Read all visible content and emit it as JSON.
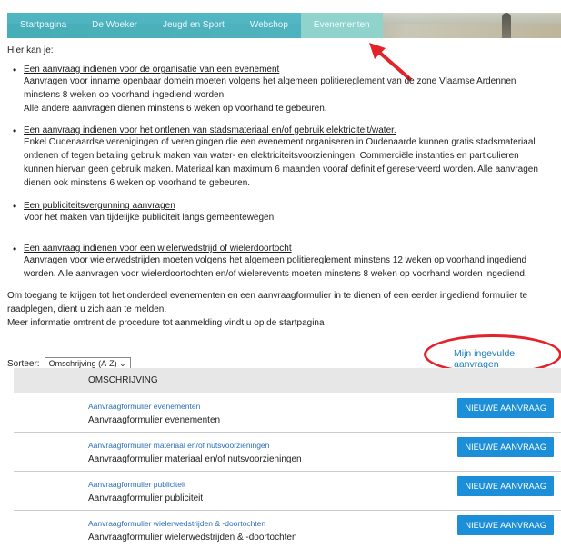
{
  "nav": {
    "items": [
      "Startpagina",
      "De Woeker",
      "Jeugd en Sport",
      "Webshop",
      "Evenementen"
    ],
    "active_index": 4
  },
  "intro": "Hier kan je:",
  "bullets": [
    {
      "title": "Een aanvraag indienen voor de organisatie van een evenement",
      "body": [
        "Aanvragen voor inname openbaar domein moeten volgens het algemeen politiereglement van de zone Vlaamse Ardennen",
        "minstens 8 weken op voorhand ingediend worden.",
        "Alle andere aanvragen dienen minstens 6 weken op voorhand te gebeuren."
      ]
    },
    {
      "title": "Een aanvraag indienen voor het ontlenen van stadsmateriaal en/of gebruik elektriciteit/water.",
      "body": [
        "Enkel Oudenaardse verenigingen of verenigingen die een evenement organiseren in Oudenaarde kunnen gratis stadsmateriaal",
        "ontlenen of tegen betaling gebruik maken van water- en elektriciteitsvoorzieningen. Commerciële instanties en particulieren",
        "kunnen hiervan geen gebruik maken. Materiaal kan maximum 6 maanden vooraf definitief gereserveerd worden. Alle aanvragen",
        "dienen ook minstens 6 weken op voorhand te gebeuren."
      ]
    },
    {
      "title": "Een publiciteitsvergunning aanvragen",
      "body": [
        "Voor het maken van tijdelijke publiciteit langs gemeentewegen"
      ]
    },
    {
      "title": "Een aanvraag indienen voor een wielerwedstrijd of wielerdoortocht",
      "body": [
        "Aanvragen voor wielerwedstrijden moeten volgens het algemeen politiereglement minstens 12 weken op voorhand ingediend",
        "worden. Alle aanvragen voor wielerdoortochten en/of wielerevents moeten minstens 8 weken op voorhand worden ingediend."
      ]
    }
  ],
  "info": [
    "Om toegang te krijgen tot het onderdeel evenementen en een aanvraagformulier in te dienen of een eerder ingediend formulier te",
    "raadplegen, dient u zich aan te melden.",
    "Meer informatie omtrent de procedure tot aanmelding vindt u op de startpagina"
  ],
  "sort": {
    "label": "Sorteer:",
    "value": "Omschrijving (A-Z)"
  },
  "my_requests": "Mijn ingevulde aanvragen",
  "table": {
    "header": "OMSCHRIJVING",
    "button_label": "NIEUWE AANVRAAG",
    "rows": [
      {
        "link": "Aanvraagformulier evenementen",
        "desc": "Aanvraagformulier evenementen"
      },
      {
        "link": "Aanvraagformulier materiaal en/of nutsvoorzieningen",
        "desc": "Aanvraagformulier materiaal en/of nutsvoorzieningen"
      },
      {
        "link": "Aanvraagformulier publiciteit",
        "desc": "Aanvraagformulier publiciteit"
      },
      {
        "link": "Aanvraagformulier wielerwedstrijden & -doortochten",
        "desc": "Aanvraagformulier wielerwedstrijden & -doortochten"
      }
    ]
  },
  "colors": {
    "accent": "#1d8fd8",
    "link": "#2a6fb6",
    "annotation": "#e3232b"
  }
}
